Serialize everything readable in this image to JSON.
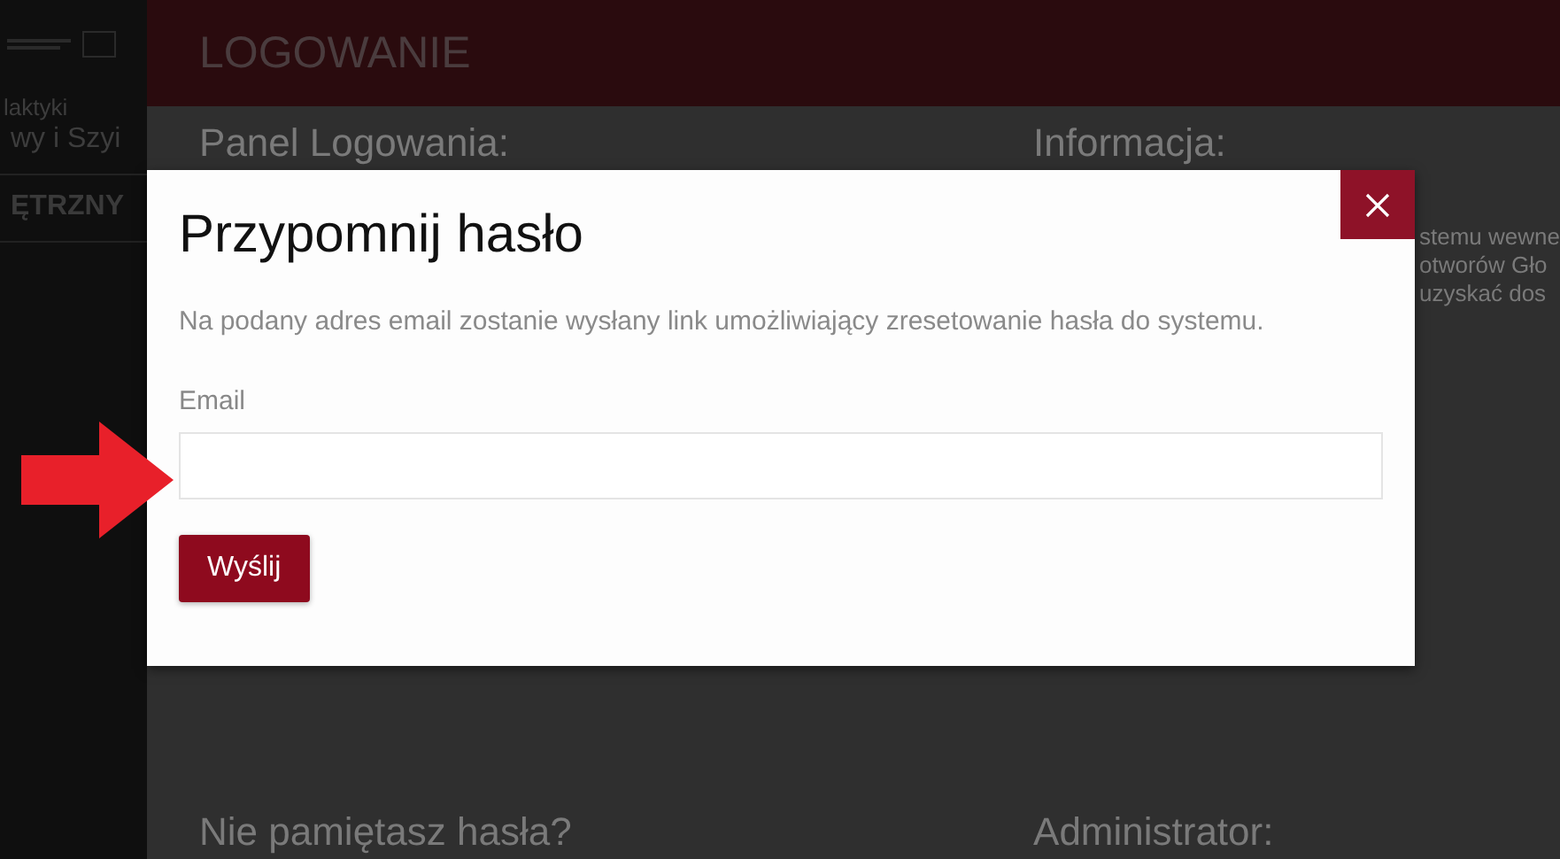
{
  "sidebar": {
    "lines": [
      "laktyki",
      "wy i Szyi"
    ],
    "section": "ĘTRZNY"
  },
  "header": {
    "title": "LOGOWANIE"
  },
  "panels": [
    {
      "heading": "Panel Logowania:"
    },
    {
      "heading": "Informacja:",
      "lines": [
        "stemu wewne",
        "otworów Gło",
        "uzyskać dos"
      ]
    }
  ],
  "bottom": [
    "Nie pamiętasz hasła?",
    "Administrator:"
  ],
  "modal": {
    "title": "Przypomnij hasło",
    "description": "Na podany adres email zostanie wysłany link umożliwiający zresetowanie hasła do systemu.",
    "field": {
      "label": "Email"
    },
    "button": "Wyślij"
  }
}
